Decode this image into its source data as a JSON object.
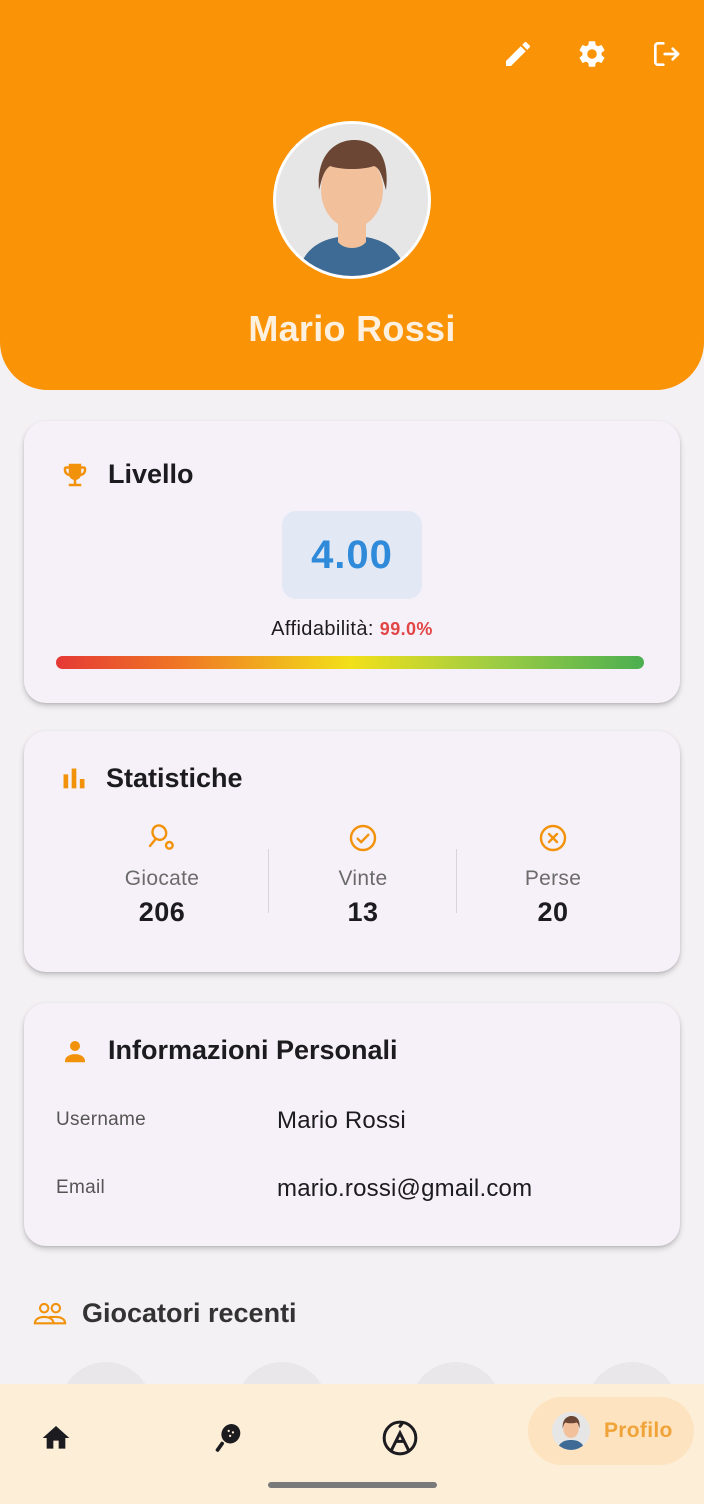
{
  "header": {
    "icons": [
      "pencil-icon",
      "gear-icon",
      "logout-icon"
    ],
    "profile_name": "Mario Rossi",
    "accent_color": "#fb9306"
  },
  "level_card": {
    "title": "Livello",
    "level_value": "4.00",
    "reliability_label": "Affidabilità:",
    "reliability_value": "99.0%",
    "reliability_fraction": 0.99
  },
  "stats_card": {
    "title": "Statistiche",
    "items": [
      {
        "label": "Giocate",
        "value": "206",
        "icon": "tennis-racket-icon"
      },
      {
        "label": "Vinte",
        "value": "13",
        "icon": "check-circle-icon"
      },
      {
        "label": "Perse",
        "value": "20",
        "icon": "x-circle-icon"
      }
    ]
  },
  "info_card": {
    "title": "Informazioni Personali",
    "rows": [
      {
        "label": "Username",
        "value": "Mario Rossi"
      },
      {
        "label": "Email",
        "value": "mario.rossi@gmail.com"
      }
    ]
  },
  "recent_players": {
    "title": "Giocatori recenti"
  },
  "bottom_nav": {
    "items": [
      {
        "icon": "home-icon"
      },
      {
        "icon": "padel-racket-icon"
      },
      {
        "icon": "court-icon"
      }
    ],
    "active_label": "Profilo"
  }
}
